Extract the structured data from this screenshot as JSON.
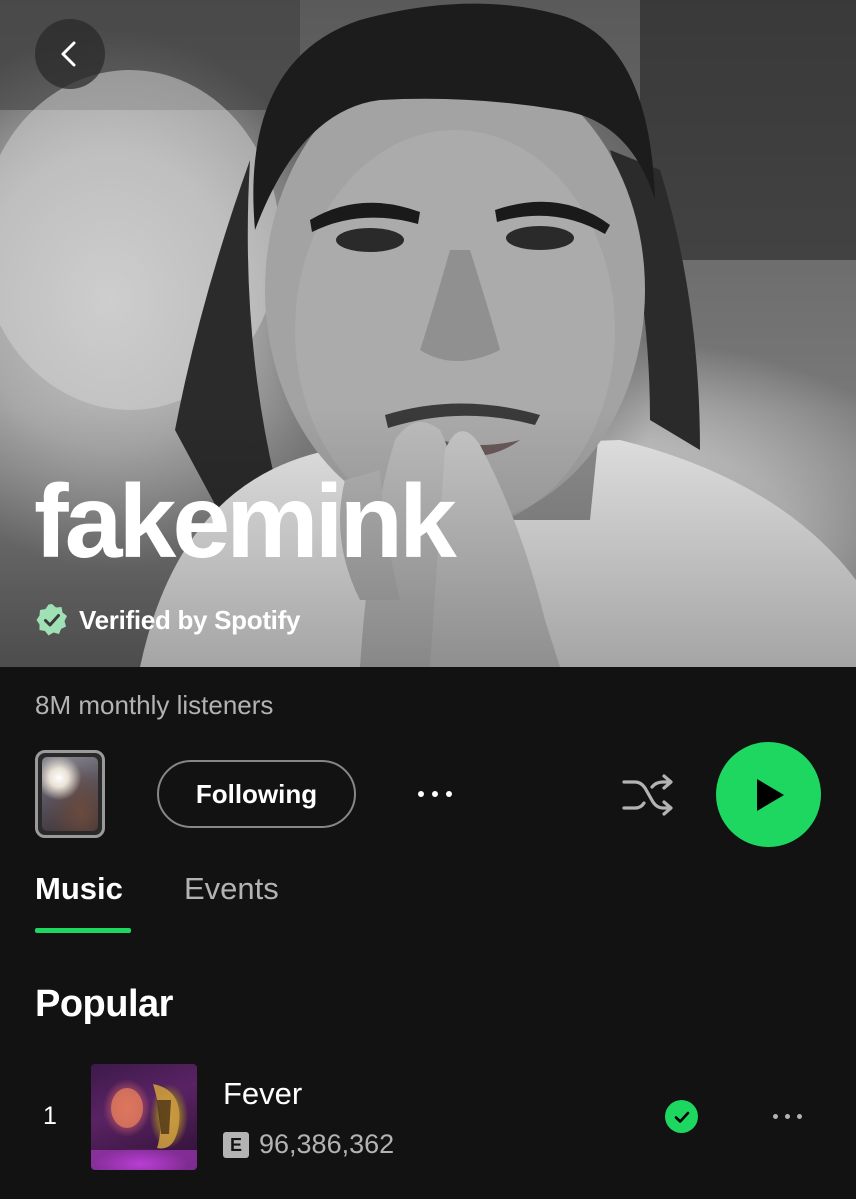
{
  "artist": {
    "name": "fakemink",
    "verified_label": "Verified by Spotify",
    "monthly_listeners": "8M monthly listeners"
  },
  "actions": {
    "follow_label": "Following",
    "shuffle_icon": "shuffle-icon",
    "play_icon": "play-icon",
    "more_icon": "more-options-icon"
  },
  "tabs": [
    {
      "label": "Music",
      "active": true
    },
    {
      "label": "Events",
      "active": false
    }
  ],
  "popular": {
    "title": "Popular",
    "tracks": [
      {
        "rank": "1",
        "title": "Fever",
        "explicit": "E",
        "plays": "96,386,362",
        "saved": true
      }
    ]
  },
  "colors": {
    "accent": "#1ed760",
    "background": "#121212",
    "secondary_text": "#b3b3b3"
  }
}
